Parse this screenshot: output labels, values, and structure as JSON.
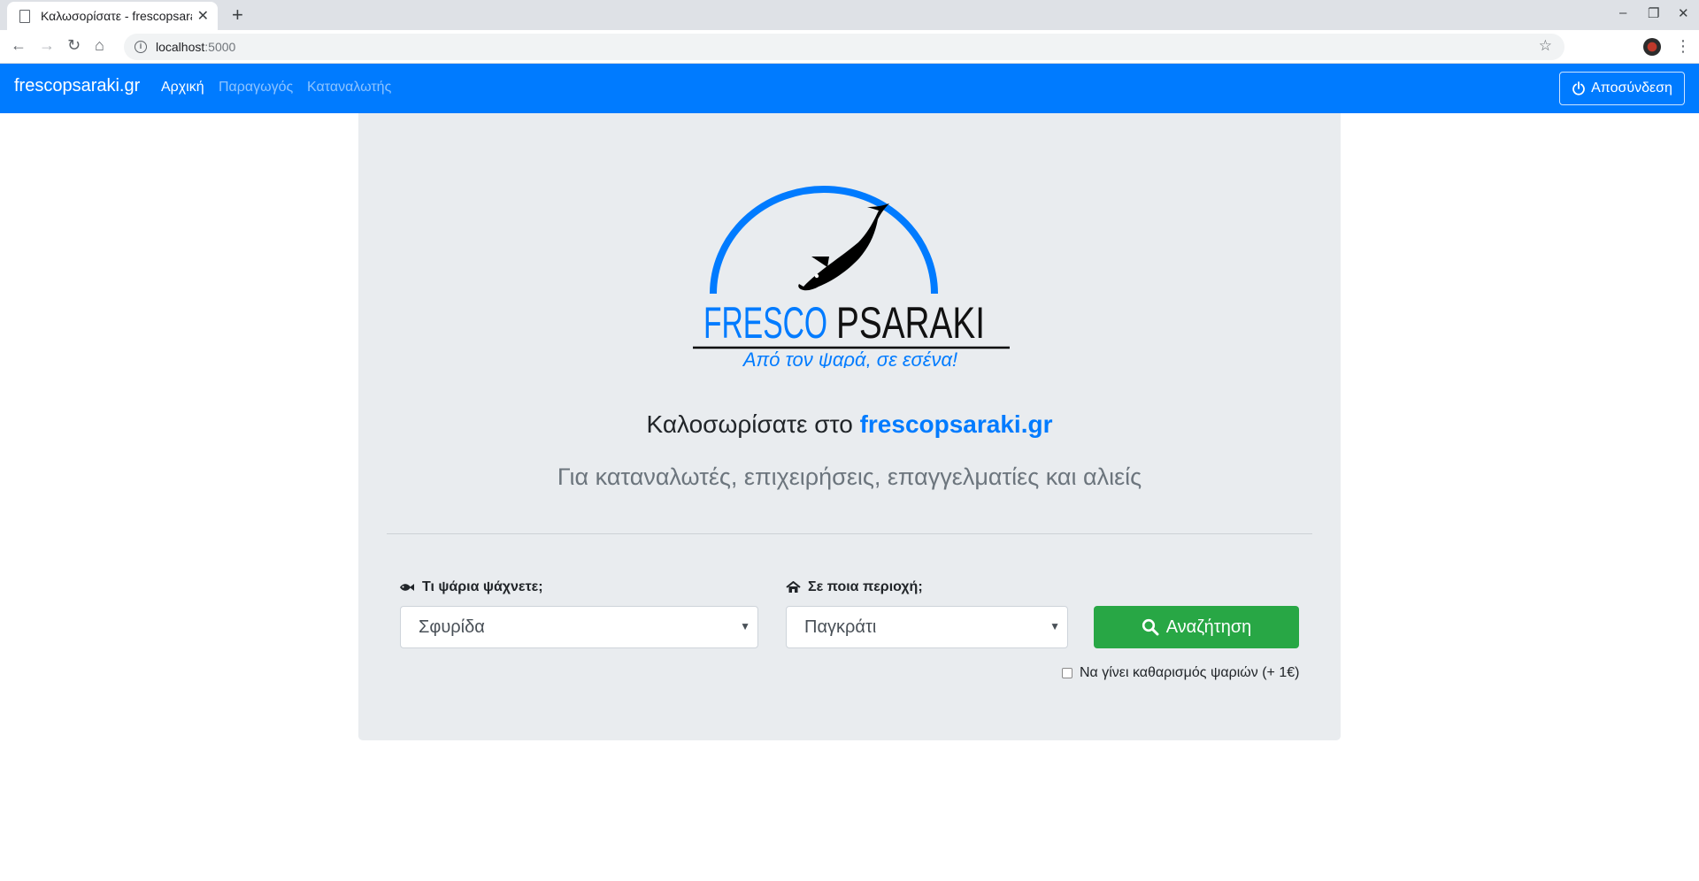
{
  "browser": {
    "tab_title": "Καλωσορίσατε - frescopsaraki",
    "url_host": "localhost",
    "url_port": ":5000"
  },
  "navbar": {
    "brand": "frescopsaraki.gr",
    "links": [
      "Αρχική",
      "Παραγωγός",
      "Καταναλωτής"
    ],
    "logout_label": "Αποσύνδεση",
    "color": "#007bff"
  },
  "logo": {
    "word1": "FRESCO",
    "word2": "PSARAKI",
    "tagline": "Από τον ψαρά, σε εσένα!"
  },
  "hero": {
    "welcome_prefix": "Καλοσωρίσατε στο",
    "welcome_site": "frescopsaraki.gr",
    "lead": "Για καταναλωτές, επιχειρήσεις, επαγγελματίες και αλιείς"
  },
  "search": {
    "fish_label": "Τι ψάρια ψάχνετε;",
    "fish_value": "Σφυρίδα",
    "area_label": "Σε ποια περιοχή;",
    "area_value": "Παγκράτι",
    "button_label": "Αναζήτηση",
    "button_color": "#28a745",
    "cleaning_label": "Να γίνει καθαρισμός ψαριών (+ 1€)",
    "cleaning_checked": false
  }
}
